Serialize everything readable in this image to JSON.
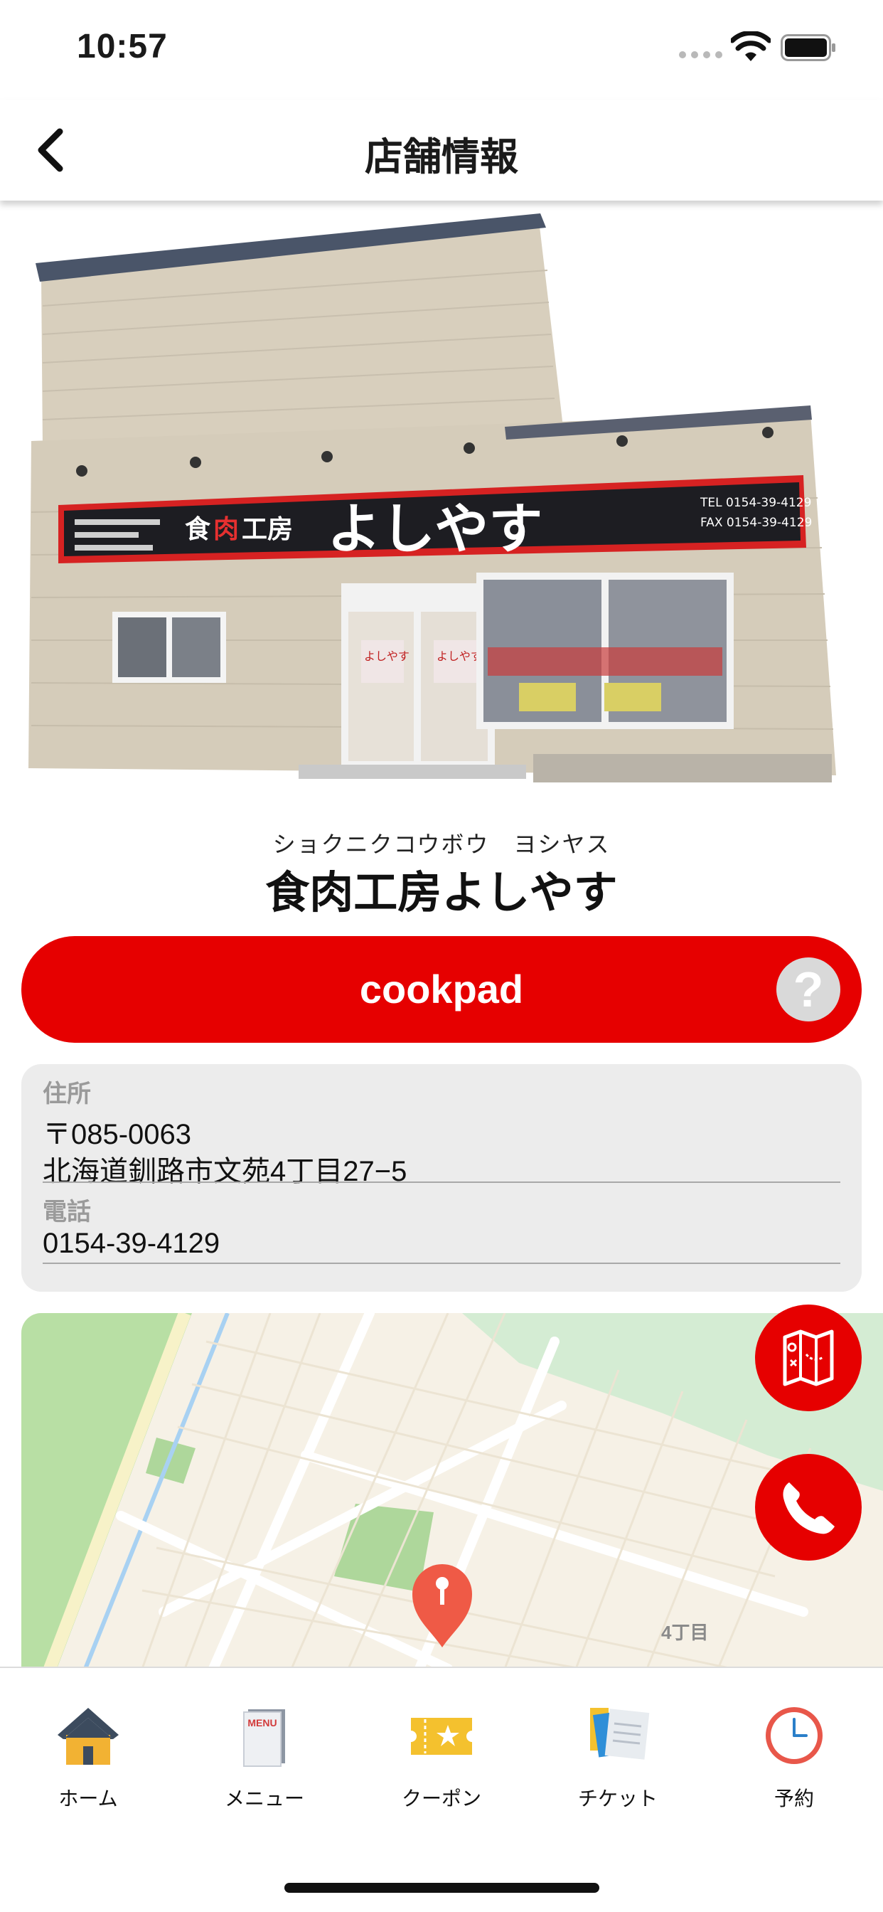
{
  "status_bar": {
    "time": "10:57"
  },
  "nav": {
    "title": "店舗情報",
    "back_icon": "chevron-left-icon"
  },
  "store": {
    "photo_sign_name": "食肉工房よしやす",
    "photo_sign_tel": "TEL 0154-39-4129",
    "photo_sign_fax": "FAX 0154-39-4129",
    "name_kana": "ショクニクコウボウ　ヨシヤス",
    "name": "食肉工房よしやす"
  },
  "cookpad": {
    "label": "cookpad",
    "help_symbol": "?"
  },
  "info": {
    "address_label": "住所",
    "postal_code": "〒085-0063",
    "address": "北海道釧路市文苑4丁目27−5",
    "phone_label": "電話",
    "phone": "0154-39-4129"
  },
  "map": {
    "district_label": "4丁目",
    "map_button_icon": "map-icon",
    "call_button_icon": "phone-icon"
  },
  "tabs": [
    {
      "label": "ホーム",
      "icon": "home-icon"
    },
    {
      "label": "メニュー",
      "icon": "menu-book-icon",
      "icon_text": "MENU"
    },
    {
      "label": "クーポン",
      "icon": "coupon-icon"
    },
    {
      "label": "チケット",
      "icon": "ticket-icon"
    },
    {
      "label": "予約",
      "icon": "clock-icon"
    }
  ],
  "colors": {
    "accent": "#e60000",
    "card_bg": "#ececec",
    "map_bg": "#f6f1e6",
    "park": "#aed79b"
  }
}
